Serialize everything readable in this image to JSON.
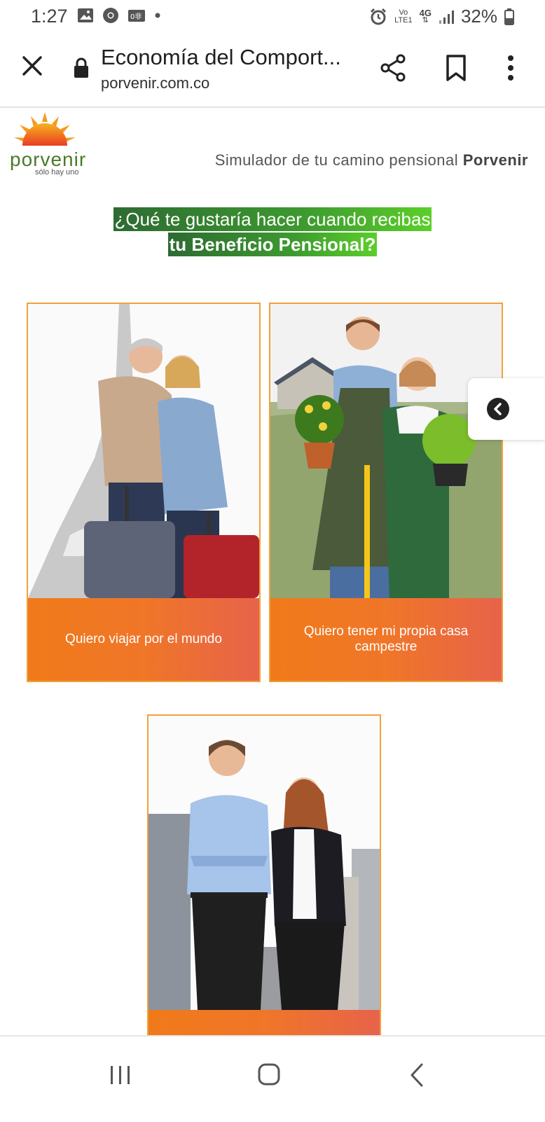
{
  "status_bar": {
    "time": "1:27",
    "network_top": "Vo",
    "network_bottom": "LTE1",
    "network_gen": "4G",
    "battery": "32%"
  },
  "toolbar": {
    "title": "Economía del Comport...",
    "url": "porvenir.com.co"
  },
  "page": {
    "logo_word": "porvenir",
    "logo_tagline": "sólo hay uno",
    "header_text": "Simulador de tu camino pensional",
    "header_brand": "Porvenir",
    "question_line1": "¿Qué te gustaría hacer cuando recibas",
    "question_line2": "tu Beneficio Pensional?",
    "cards": [
      {
        "label": "Quiero viajar por el mundo"
      },
      {
        "label": "Quiero tener mi propia casa campestre"
      },
      {
        "label": ""
      }
    ]
  },
  "colors": {
    "accent_orange": "#f07a1a",
    "accent_green": "#3d9a2f",
    "card_border": "#f0a23a"
  }
}
